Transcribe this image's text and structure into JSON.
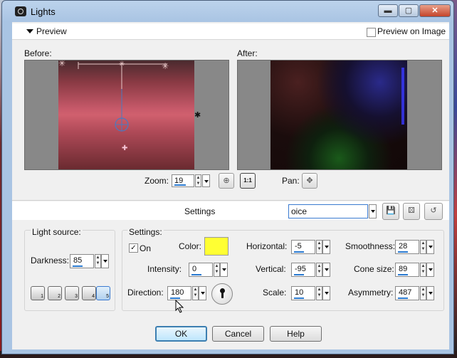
{
  "window": {
    "title": "Lights",
    "minimize": "▬",
    "maximize": "▢",
    "close": "✕"
  },
  "preview": {
    "label": "Preview",
    "preview_on_image_label": "Preview on Image",
    "preview_on_image_checked": false
  },
  "before_label": "Before:",
  "after_label": "After:",
  "zoom": {
    "label": "Zoom:",
    "value": "19",
    "ratio_label": "1:1"
  },
  "pan": {
    "label": "Pan:"
  },
  "settings_bar": {
    "label": "Settings",
    "preset_value": "oice"
  },
  "light_source": {
    "title": "Light source:",
    "darkness_label": "Darkness:",
    "darkness_value": "85",
    "light_buttons": [
      "1",
      "2",
      "3",
      "4",
      "5"
    ],
    "selected_light": "5"
  },
  "settings": {
    "title": "Settings:",
    "on_label": "On",
    "on_checked": true,
    "color_label": "Color:",
    "color_value": "#ffff33",
    "intensity_label": "Intensity:",
    "intensity_value": "0",
    "direction_label": "Direction:",
    "direction_value": "180",
    "horizontal_label": "Horizontal:",
    "horizontal_value": "-5",
    "vertical_label": "Vertical:",
    "vertical_value": "-95",
    "scale_label": "Scale:",
    "scale_value": "10",
    "smoothness_label": "Smoothness:",
    "smoothness_value": "28",
    "cone_size_label": "Cone size:",
    "cone_size_value": "89",
    "asymmetry_label": "Asymmetry:",
    "asymmetry_value": "487"
  },
  "buttons": {
    "ok": "OK",
    "cancel": "Cancel",
    "help": "Help"
  }
}
